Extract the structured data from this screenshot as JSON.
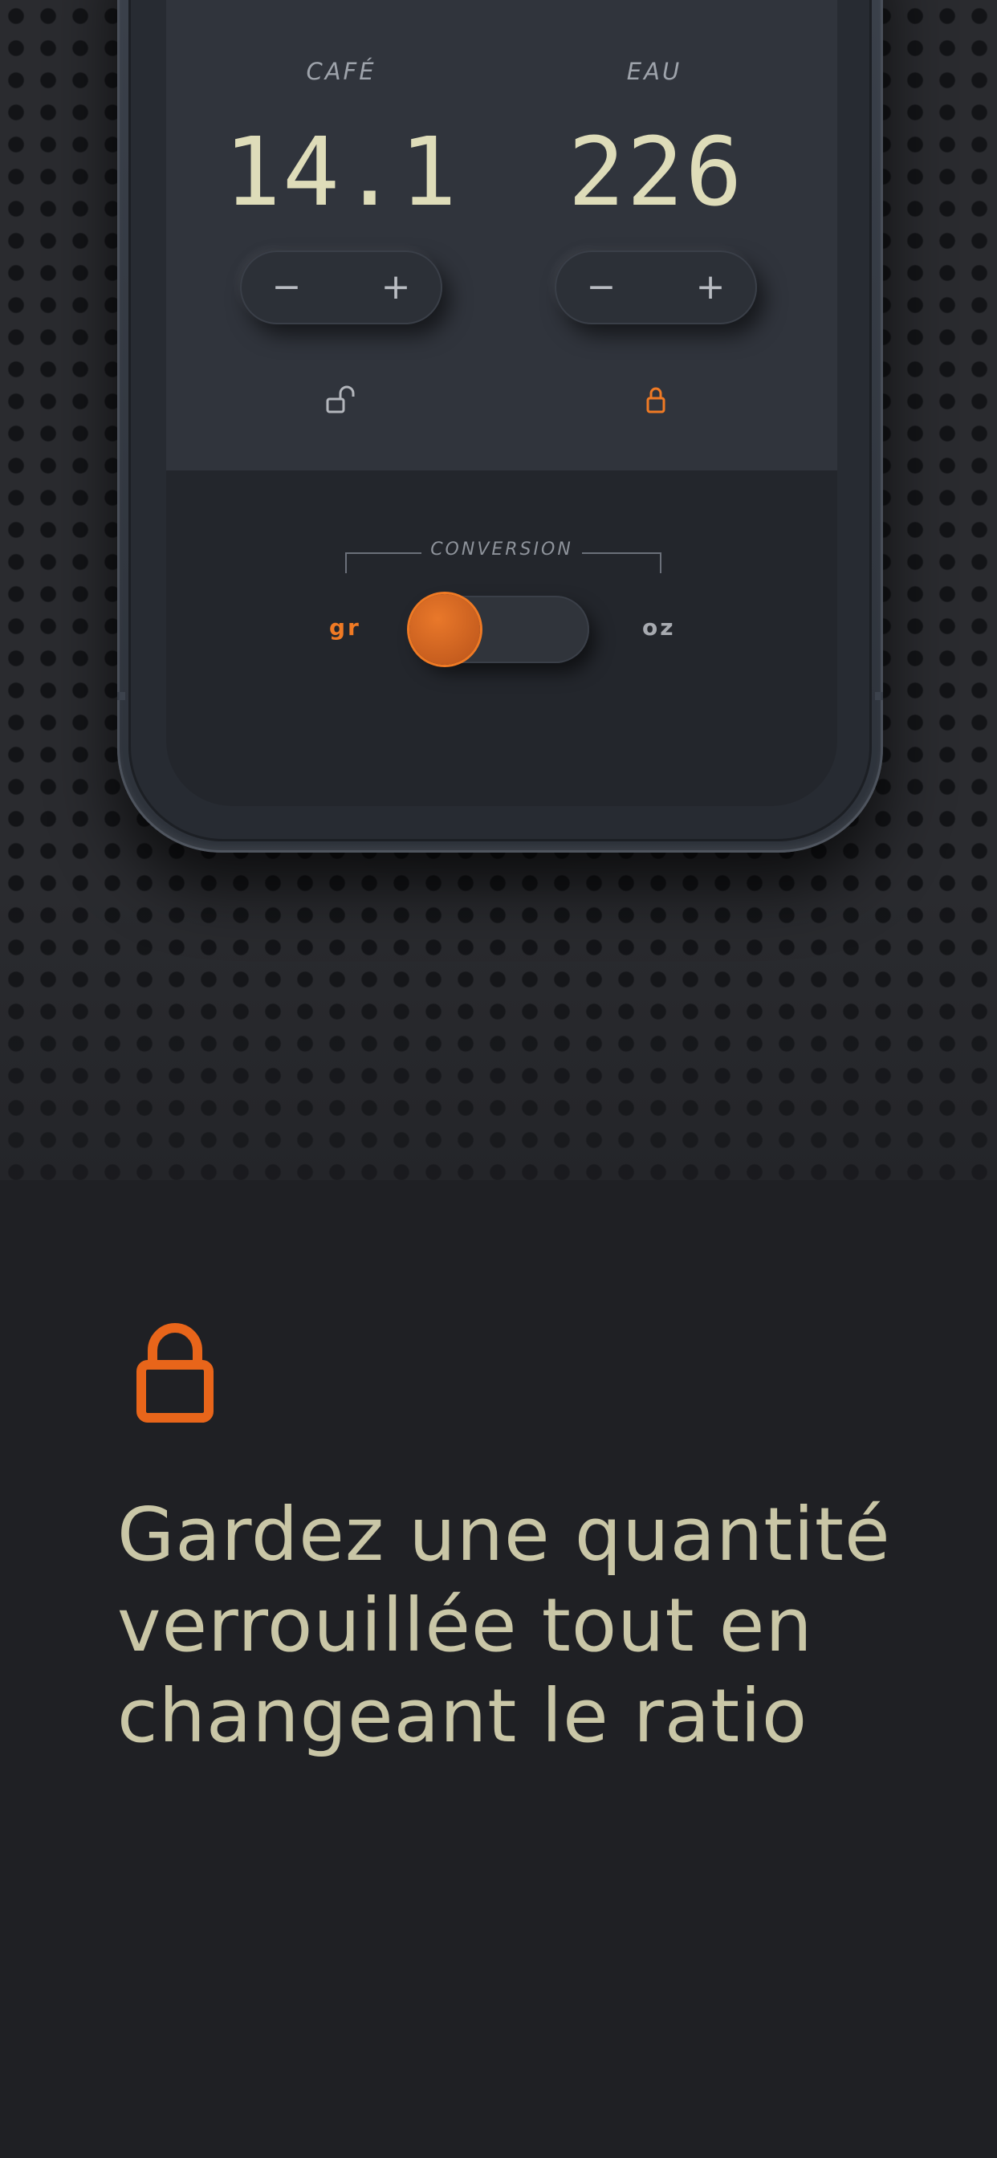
{
  "coffee": {
    "label": "CAFÉ",
    "value": "14.1",
    "minus_label": "−",
    "plus_label": "+",
    "lock_icon": "lock-open-icon"
  },
  "water": {
    "label": "EAU",
    "value": "226",
    "minus_label": "−",
    "plus_label": "+",
    "lock_icon": "lock-closed-icon"
  },
  "conversion": {
    "label": "CONVERSION",
    "unit_left": "gr",
    "unit_right": "oz",
    "selected": "gr"
  },
  "feature": {
    "icon": "lock-icon",
    "headline": "Gardez une quantité verrouillée tout en changeant le ratio"
  },
  "colors": {
    "accent": "#f07a24",
    "text_value": "#dedcb9",
    "headline": "#c9c6a6",
    "background": "#1f2024"
  }
}
